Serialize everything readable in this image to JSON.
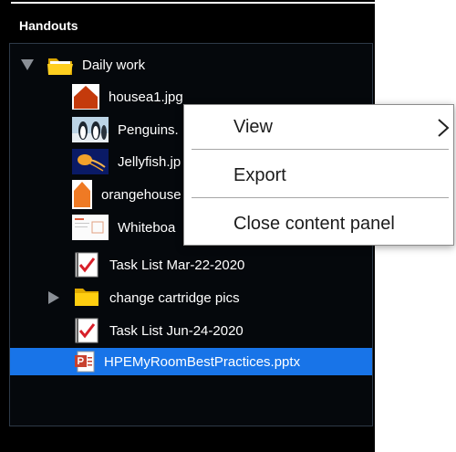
{
  "panel": {
    "title": "Handouts"
  },
  "tree": {
    "folder_daily_work": "Daily work",
    "items": [
      {
        "label": "housea1.jpg",
        "icon": "house-thumbnail-icon"
      },
      {
        "label": "Penguins.",
        "icon": "penguins-thumbnail-icon"
      },
      {
        "label": "Jellyfish.jp",
        "icon": "jellyfish-thumbnail-icon"
      },
      {
        "label": "orangehouse",
        "icon": "orange-house-thumbnail-icon"
      },
      {
        "label": "Whiteboa",
        "icon": "whiteboard-thumbnail-icon"
      },
      {
        "label": "Task List Mar-22-2020",
        "icon": "task-list-icon"
      }
    ],
    "folder_change_cartridge": "change cartridge pics",
    "task_list_jun": "Task List Jun-24-2020",
    "selected_file": "HPEMyRoomBestPractices.pptx"
  },
  "context_menu": {
    "view": "View",
    "export": "Export",
    "close": "Close content panel"
  },
  "colors": {
    "panel_bg": "#000000",
    "selection": "#1874e8",
    "menu_bg": "#ffffff",
    "chevron": "#8a8f96"
  }
}
